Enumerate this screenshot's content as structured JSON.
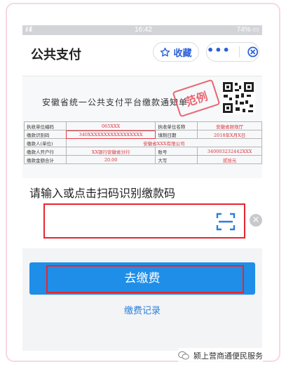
{
  "status": {
    "signal": "ıl ıll",
    "time": "16:42",
    "battery": "74%"
  },
  "header": {
    "title": "公共支付",
    "collect_label": "收藏",
    "more_label": "•••"
  },
  "notice": {
    "title": "安徽省统一公共支付平台缴款通知单",
    "stamp": "范例",
    "rows": [
      [
        "执收单位编码",
        "065XXX",
        "执收单位名称",
        "安徽省财政厅"
      ],
      [
        "缴款识别码",
        "340XXXXXXXXXXXXXXXXX",
        "填制日期",
        "2018年X月X日"
      ],
      [
        "缴款人(单位)",
        "安徽省XXX有限公司"
      ],
      [
        "缴款人开户行",
        "XX银行安徽省分行",
        "账号",
        "340003232442XXX"
      ],
      [
        "缴款金额合计",
        "20.00",
        "大写",
        "贰拾元"
      ]
    ]
  },
  "prompt": "请输入或点击扫码识别缴款码",
  "input": {
    "value": "",
    "placeholder": ""
  },
  "pay_label": "去缴费",
  "records_label": "缴费记录",
  "watermark": "颍上营商通便民服务",
  "colors": {
    "accent": "#1f8ee8",
    "highlight": "#e5262f",
    "link": "#2a7fdb"
  }
}
